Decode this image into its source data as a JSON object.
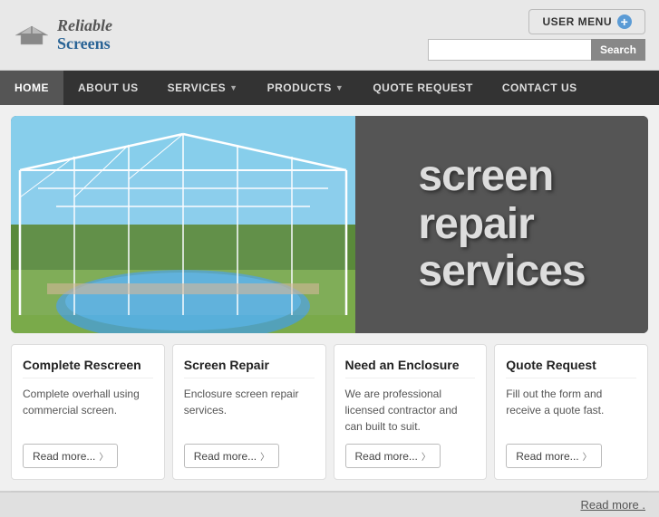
{
  "header": {
    "logo_text_reliable": "Reliable",
    "logo_text_screens": "Screens",
    "user_menu_label": "USER MENU",
    "user_menu_plus": "+",
    "search_placeholder": "",
    "search_btn_label": "Search"
  },
  "nav": {
    "items": [
      {
        "label": "HOME",
        "active": true,
        "has_dropdown": false
      },
      {
        "label": "ABOUT US",
        "active": false,
        "has_dropdown": false
      },
      {
        "label": "SERVICES",
        "active": false,
        "has_dropdown": true
      },
      {
        "label": "PRODUCTS",
        "active": false,
        "has_dropdown": true
      },
      {
        "label": "QUOTE REQUEST",
        "active": false,
        "has_dropdown": false
      },
      {
        "label": "CONTACT US",
        "active": false,
        "has_dropdown": false
      }
    ]
  },
  "hero": {
    "title_line1": "screen",
    "title_line2": "repair",
    "title_line3": "services"
  },
  "cards": [
    {
      "title": "Complete Rescreen",
      "text": "Complete overhall using commercial screen.",
      "read_more": "Read more..."
    },
    {
      "title": "Screen Repair",
      "text": "Enclosure screen repair services.",
      "read_more": "Read more..."
    },
    {
      "title": "Need an Enclosure",
      "text": "We are professional licensed contractor and can built to suit.",
      "read_more": "Read more..."
    },
    {
      "title": "Quote Request",
      "text": "Fill out the form and receive a quote fast.",
      "read_more": "Read more..."
    }
  ],
  "footer": {
    "read_more_text": "Read more ."
  }
}
